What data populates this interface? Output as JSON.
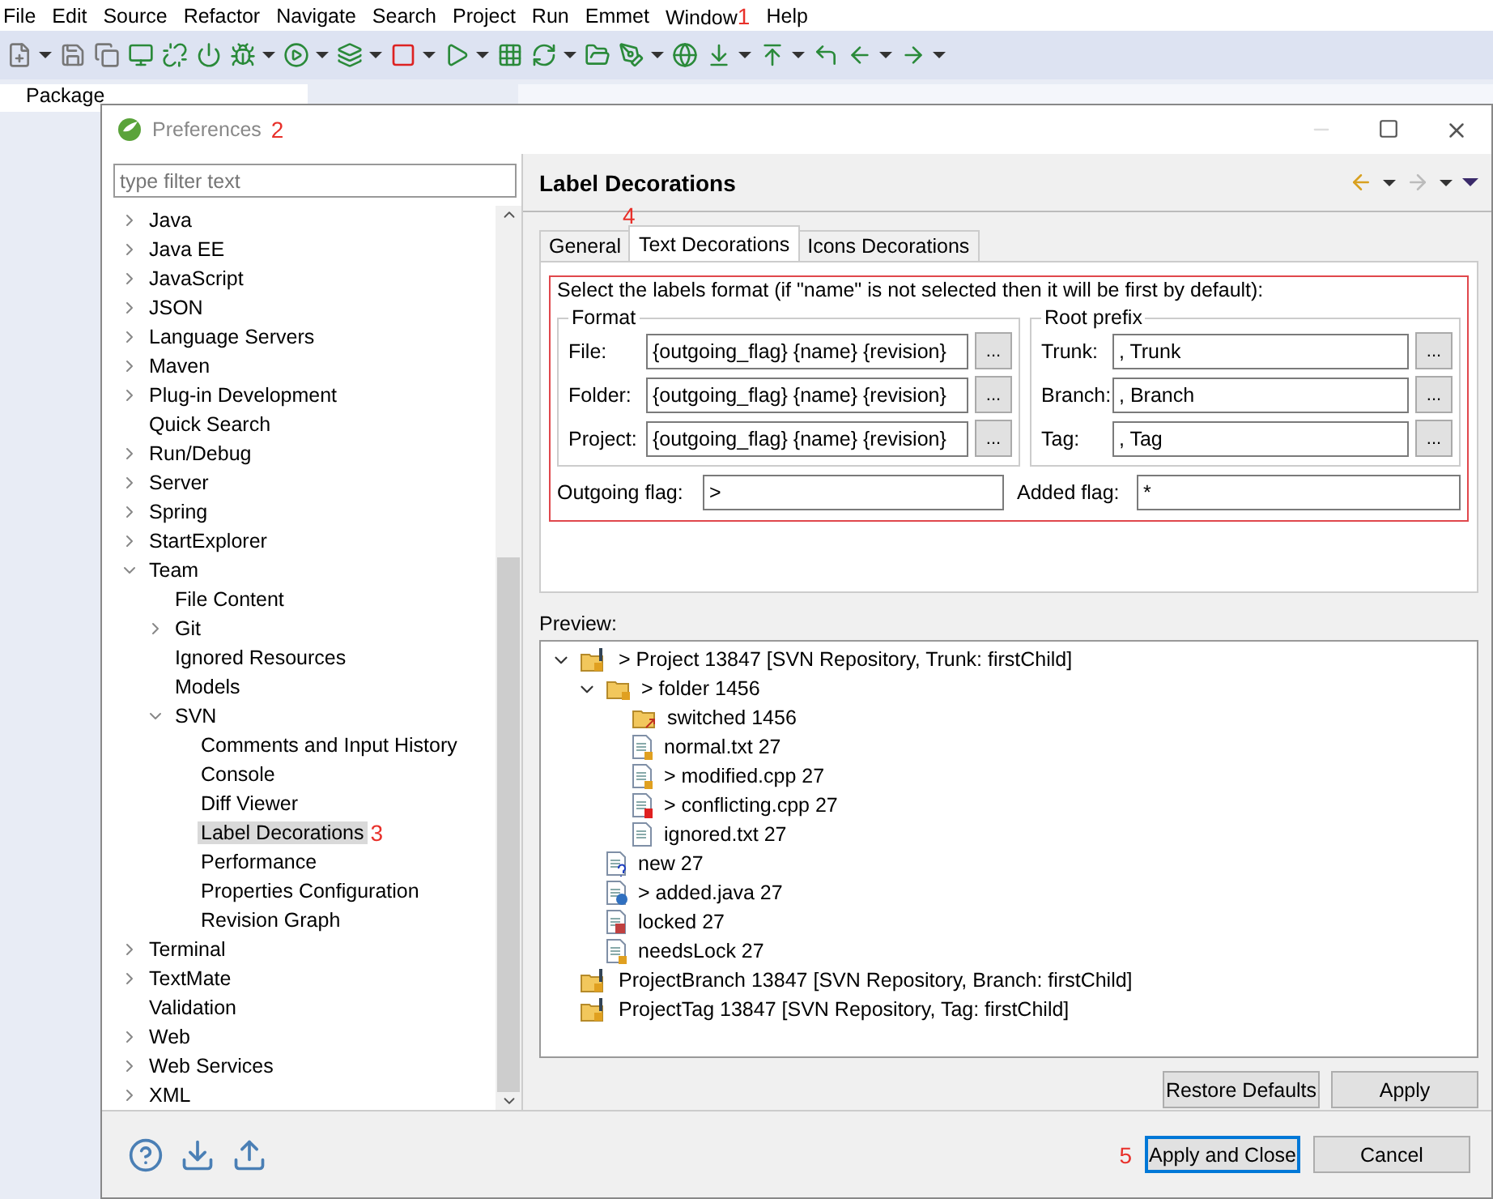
{
  "menu": [
    {
      "label": "File"
    },
    {
      "label": "Edit"
    },
    {
      "label": "Source"
    },
    {
      "label": "Refactor"
    },
    {
      "label": "Navigate"
    },
    {
      "label": "Search"
    },
    {
      "label": "Project"
    },
    {
      "label": "Run"
    },
    {
      "label": "Emmet"
    },
    {
      "label": "Window",
      "annotation": "1"
    },
    {
      "label": "Help"
    }
  ],
  "views": {
    "package_explorer": "Package"
  },
  "dialog": {
    "title": "Preferences",
    "annotation": "2",
    "filter": {
      "placeholder": "type filter text"
    },
    "tree": [
      {
        "label": "Java",
        "expanded": false,
        "selected": false
      },
      {
        "label": "Java EE",
        "expanded": false,
        "selected": false
      },
      {
        "label": "JavaScript",
        "expanded": false,
        "selected": false
      },
      {
        "label": "JSON",
        "expanded": false,
        "selected": false
      },
      {
        "label": "Language Servers",
        "expanded": false,
        "selected": false
      },
      {
        "label": "Maven",
        "expanded": false,
        "selected": false
      },
      {
        "label": "Plug-in Development",
        "expanded": false,
        "selected": false
      },
      {
        "label": "Quick Search",
        "selected": false
      },
      {
        "label": "Run/Debug",
        "expanded": false,
        "selected": false
      },
      {
        "label": "Server",
        "expanded": false,
        "selected": false
      },
      {
        "label": "Spring",
        "expanded": false,
        "selected": false
      },
      {
        "label": "StartExplorer",
        "expanded": false,
        "selected": false
      },
      {
        "label": "Team",
        "expanded": true,
        "selected": false,
        "children": [
          {
            "label": "File Content",
            "selected": false
          },
          {
            "label": "Git",
            "expanded": false,
            "selected": false
          },
          {
            "label": "Ignored Resources",
            "selected": false
          },
          {
            "label": "Models",
            "selected": false
          },
          {
            "label": "SVN",
            "expanded": true,
            "selected": false,
            "children": [
              {
                "label": "Comments and Input History",
                "selected": false
              },
              {
                "label": "Console",
                "selected": false
              },
              {
                "label": "Diff Viewer",
                "selected": false
              },
              {
                "label": "Label Decorations",
                "selected": true,
                "annotation": "3"
              },
              {
                "label": "Performance",
                "selected": false
              },
              {
                "label": "Properties Configuration",
                "selected": false
              },
              {
                "label": "Revision Graph",
                "selected": false
              }
            ]
          }
        ]
      },
      {
        "label": "Terminal",
        "expanded": false,
        "selected": false
      },
      {
        "label": "TextMate",
        "expanded": false,
        "selected": false
      },
      {
        "label": "Validation",
        "selected": false
      },
      {
        "label": "Web",
        "expanded": false,
        "selected": false
      },
      {
        "label": "Web Services",
        "expanded": false,
        "selected": false
      },
      {
        "label": "XML",
        "expanded": false,
        "selected": false
      }
    ],
    "page_title": "Label Decorations",
    "tabs": [
      {
        "label": "General",
        "selected": false
      },
      {
        "label": "Text Decorations",
        "selected": true,
        "annotation": "4"
      },
      {
        "label": "Icons Decorations",
        "selected": false
      }
    ],
    "description": "Select the labels format (if \"name\" is not selected then it will be first by default):",
    "format": {
      "title": "Format",
      "fields": [
        {
          "label": "File:",
          "value": "{outgoing_flag} {name} {revision}",
          "button": "..."
        },
        {
          "label": "Folder:",
          "value": "{outgoing_flag} {name} {revision}",
          "button": "..."
        },
        {
          "label": "Project:",
          "value": "{outgoing_flag} {name} {revision}",
          "button": "..."
        }
      ]
    },
    "root_prefix": {
      "title": "Root prefix",
      "fields": [
        {
          "label": "Trunk:",
          "value": ", Trunk",
          "button": "..."
        },
        {
          "label": "Branch:",
          "value": ", Branch",
          "button": "..."
        },
        {
          "label": "Tag:",
          "value": ", Tag",
          "button": "..."
        }
      ]
    },
    "outgoing_flag": {
      "label": "Outgoing flag:",
      "value": ">"
    },
    "added_flag": {
      "label": "Added flag:",
      "value": "*"
    },
    "preview_label": "Preview:",
    "preview": [
      {
        "label": "> Project 13847 [SVN Repository, Trunk: firstChild]",
        "kind": "project",
        "expanded": true,
        "children": [
          {
            "label": "> folder 1456",
            "kind": "folder",
            "expanded": true,
            "children": [
              {
                "label": "switched 1456",
                "kind": "switched"
              },
              {
                "label": "normal.txt 27",
                "kind": "file"
              },
              {
                "label": "> modified.cpp 27",
                "kind": "file"
              },
              {
                "label": "> conflicting.cpp 27",
                "kind": "conflict"
              },
              {
                "label": "ignored.txt 27",
                "kind": "ignored"
              }
            ]
          },
          {
            "label": "new 27",
            "kind": "new"
          },
          {
            "label": "> added.java 27",
            "kind": "added"
          },
          {
            "label": "locked 27",
            "kind": "locked"
          },
          {
            "label": "needsLock 27",
            "kind": "file"
          }
        ]
      },
      {
        "label": "ProjectBranch 13847 [SVN Repository, Branch: firstChild]",
        "kind": "project"
      },
      {
        "label": "ProjectTag 13847 [SVN Repository, Tag: firstChild]",
        "kind": "project"
      }
    ],
    "restore_defaults": "Restore Defaults",
    "apply": "Apply",
    "footer_annotation": "5",
    "apply_and_close": "Apply and Close",
    "cancel": "Cancel"
  }
}
